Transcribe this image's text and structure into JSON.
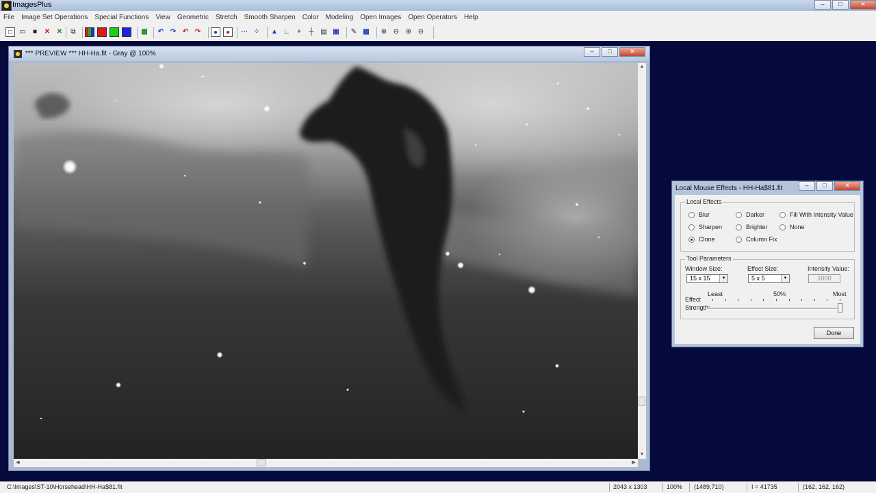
{
  "app": {
    "title": "ImagesPlus"
  },
  "window_controls": {
    "minimize": "–",
    "maximize": "□",
    "close": "✕"
  },
  "menu": [
    "File",
    "Image Set Operations",
    "Special Functions",
    "View",
    "Geometric",
    "Stretch",
    "Smooth Sharpen",
    "Color",
    "Modeling",
    "Open Images",
    "Open Operators",
    "Help"
  ],
  "toolbar": {
    "buttons": [
      {
        "name": "new-icon",
        "glyph": "□"
      },
      {
        "name": "open-icon",
        "glyph": "▭"
      },
      {
        "name": "save-icon",
        "glyph": "■"
      },
      {
        "name": "close-image-icon",
        "glyph": "✕"
      },
      {
        "name": "close-all-icon",
        "glyph": "✕"
      },
      {
        "name": "copy-icon",
        "glyph": "⧉"
      },
      {
        "name": "rgb-icon",
        "glyph": ""
      },
      {
        "name": "red-channel-icon",
        "glyph": ""
      },
      {
        "name": "green-channel-icon",
        "glyph": ""
      },
      {
        "name": "blue-channel-icon",
        "glyph": ""
      },
      {
        "name": "grid-icon",
        "glyph": "▦"
      },
      {
        "name": "undo-icon",
        "glyph": "↶"
      },
      {
        "name": "redo-icon",
        "glyph": "↷"
      },
      {
        "name": "undo-all-icon",
        "glyph": "↶"
      },
      {
        "name": "redo-all-icon",
        "glyph": "↷"
      },
      {
        "name": "star-select-icon",
        "glyph": "●"
      },
      {
        "name": "star-mask-icon",
        "glyph": "●"
      },
      {
        "name": "line-profile-icon",
        "glyph": "⋯"
      },
      {
        "name": "star-plot-icon",
        "glyph": "⁘"
      },
      {
        "name": "histogram-icon",
        "glyph": "▲"
      },
      {
        "name": "axis-icon",
        "glyph": "∟"
      },
      {
        "name": "crosshair-icon",
        "glyph": "+"
      },
      {
        "name": "target-icon",
        "glyph": "┼"
      },
      {
        "name": "calculator-icon",
        "glyph": "▤"
      },
      {
        "name": "image-info-icon",
        "glyph": "▣"
      },
      {
        "name": "pencil-icon",
        "glyph": "✎"
      },
      {
        "name": "pixel-grid-icon",
        "glyph": "▦"
      },
      {
        "name": "zoom-in-icon",
        "glyph": "⊕"
      },
      {
        "name": "zoom-out-icon",
        "glyph": "⊖"
      },
      {
        "name": "zoom-fit-icon",
        "glyph": "⊕"
      },
      {
        "name": "zoom-actual-icon",
        "glyph": "⊖"
      }
    ]
  },
  "image_window": {
    "title": "*** PREVIEW *** HH-Ha.fit - Gray @ 100%"
  },
  "dialog": {
    "title": "Local Mouse Effects - HH-Ha$81.fit",
    "local_effects": {
      "label": "Local Effects",
      "options": [
        {
          "label": "Blur",
          "checked": false
        },
        {
          "label": "Darker",
          "checked": false
        },
        {
          "label": "Fill With Intensity Value",
          "checked": false
        },
        {
          "label": "Sharpen",
          "checked": false
        },
        {
          "label": "Brighter",
          "checked": false
        },
        {
          "label": "None",
          "checked": false
        },
        {
          "label": "Clone",
          "checked": true
        },
        {
          "label": "Column Fix",
          "checked": false
        }
      ]
    },
    "tool_parameters": {
      "label": "Tool Parameters",
      "window_size": {
        "label": "Window Size:",
        "value": "15 x 15"
      },
      "effect_size": {
        "label": "Effect Size:",
        "value": "5 x 5"
      },
      "intensity_value": {
        "label": "Intensity Value:",
        "value": "1000"
      },
      "strength": {
        "label_line1": "Effect",
        "label_line2": "Strength:",
        "least": "Least",
        "mid": "50%",
        "most": "Most",
        "value_fraction": 1.0
      }
    },
    "done_label": "Done"
  },
  "status": {
    "path": "C:\\Images\\ST-10\\Horsehead\\HH-Ha$81.fit",
    "dimensions": "2043 x 1303",
    "zoom": "100%",
    "cursor": "(1489,710)",
    "intensity": "I = 41735",
    "rgb": "(162, 162, 162)"
  }
}
